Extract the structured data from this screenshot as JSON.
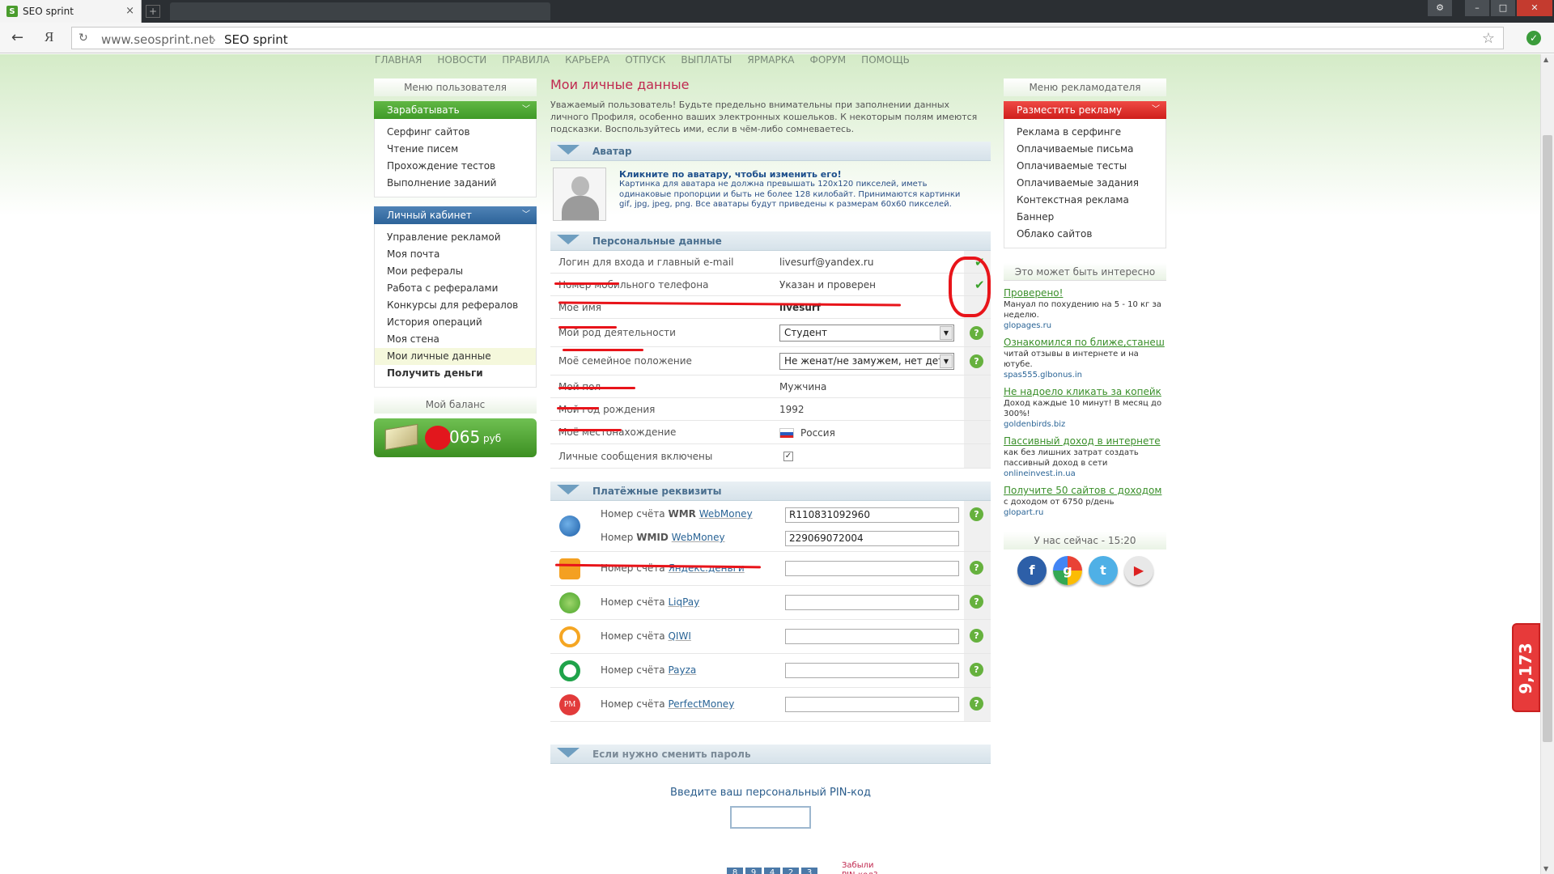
{
  "browser": {
    "tab_title": "SEO sprint",
    "tab_close": "×",
    "favicon": "S",
    "nav_back": "←",
    "nav_yandex": "Я",
    "reload": "↻",
    "url": "www.seosprint.net",
    "url_sep": "›",
    "page_title": "SEO sprint",
    "star": "☆",
    "ext": "✓",
    "new_tab": "+",
    "settings": "⚙",
    "minimize": "–",
    "maximize": "□",
    "close": "✕"
  },
  "topnav": [
    "ГЛАВНАЯ",
    "НОВОСТИ",
    "ПРАВИЛА",
    "КАРЬЕРА",
    "ОТПУСК",
    "ВЫПЛАТЫ",
    "ЯРМАРКА",
    "ФОРУМ",
    "ПОМОЩЬ"
  ],
  "left": {
    "title": "Меню пользователя",
    "earn_head": "Зарабатывать",
    "earn_items": [
      "Серфинг сайтов",
      "Чтение писем",
      "Прохождение тестов",
      "Выполнение заданий"
    ],
    "cabinet_head": "Личный кабинет",
    "cabinet_items": [
      "Управление рекламой",
      "Моя почта",
      "Мои рефералы",
      "Работа с рефералами",
      "Конкурсы для рефералов",
      "История операций",
      "Моя стена",
      "Мои личные данные",
      "Получить деньги"
    ],
    "balance_title": "Мой баланс",
    "balance_amount": "065",
    "balance_currency": "руб",
    "chevron": "﹀"
  },
  "main": {
    "title": "Мои личные данные",
    "intro": "Уважаемый пользователь! Будьте предельно внимательны при заполнении данных личного Профиля, особенно ваших электронных кошельков. К некоторым полям имеются подсказки. Воспользуйтесь ими, если в чём-либо сомневаетесь.",
    "avatar_section": "Аватар",
    "avatar_title": "Кликните по аватару, чтобы изменить его!",
    "avatar_desc": "Картинка для аватара не должна превышать 120х120 пикселей, иметь одинаковые пропорции и быть не более 128 килобайт. Принимаются картинки gif, jpg, jpeg, png. Все аватары будут приведены к размерам 60х60 пикселей.",
    "personal_section": "Персональные данные",
    "rows": {
      "login_label": "Логин для входа и главный e-mail",
      "login_value": "livesurf@yandex.ru",
      "phone_label": "Номер мобильного телефона",
      "phone_value": "Указан и проверен",
      "name_label": "Моё имя",
      "name_value": "livesurf",
      "occupation_label": "Мой род деятельности",
      "occupation_value": "Студент",
      "marital_label": "Моё семейное положение",
      "marital_value": "Не женат/не замужем, нет дете",
      "gender_label": "Мой пол",
      "gender_value": "Мужчина",
      "birth_label": "Мой год рождения",
      "birth_value": "1992",
      "location_label": "Моё местонахождение",
      "location_value": "Россия",
      "messages_label": "Личные сообщения включены",
      "messages_checked": "✓"
    },
    "check": "✔",
    "help": "?",
    "select_arrow": "▼",
    "payment_section": "Платёжные реквизиты",
    "payments": {
      "wmr_prefix": "Номер счёта ",
      "wmr_bold": "WMR",
      "wmr_link": "WebMoney",
      "wmr_value": "R110831092960",
      "wmid_prefix": "Номер ",
      "wmid_bold": "WMID",
      "wmid_link": "WebMoney",
      "wmid_value": "229069072004",
      "prefix": "Номер счёта ",
      "yandex_link": "Яндекс.деньги",
      "liqpay_link": "LiqPay",
      "qiwi_link": "QIWI",
      "payza_link": "Payza",
      "pm_link": "PerfectMoney",
      "pm_icon": "PM"
    },
    "password_section": "Если нужно сменить пароль",
    "pin_label": "Введите ваш персональный PIN-код",
    "pin_keys": [
      "8",
      "9",
      "4",
      "2",
      "3"
    ],
    "forgot_pin": "Забыли PIN-код?"
  },
  "right": {
    "title": "Меню рекламодателя",
    "place_ad_head": "Разместить рекламу",
    "ad_items": [
      "Реклама в серфинге",
      "Оплачиваемые письма",
      "Оплачиваемые тесты",
      "Оплачиваемые задания",
      "Контекстная реклама",
      "Баннер",
      "Облако сайтов"
    ],
    "interest_title": "Это может быть интересно",
    "ads": [
      {
        "title": "Проверено!",
        "desc": "Мануал по похудению на 5 - 10 кг за неделю.",
        "url": "glopages.ru"
      },
      {
        "title": "Ознакомился по ближе,станеш",
        "desc": "читай отзывы в интернете и на ютубе.",
        "url": "spas555.glbonus.in"
      },
      {
        "title": "Не надоело кликать за копейк",
        "desc": "Доход каждые 10 минут! В месяц до 300%!",
        "url": "goldenbirds.biz"
      },
      {
        "title": "Пассивный доход в интернете",
        "desc": "как без лишних затрат создать пассивный доход в сети",
        "url": "onlineinvest.in.ua"
      },
      {
        "title": "Получите 50 сайтов с доходом",
        "desc": "с доходом от 6750 р/день",
        "url": "glopart.ru"
      }
    ],
    "now_title": "У нас сейчас - 15:20",
    "socials": [
      "f",
      "g",
      "t",
      "▶"
    ]
  },
  "widget": {
    "text": "9,173"
  },
  "colors": {
    "accent_red": "#e8141a",
    "brand_green": "#4a9c2d",
    "title_pink": "#c0284f"
  }
}
